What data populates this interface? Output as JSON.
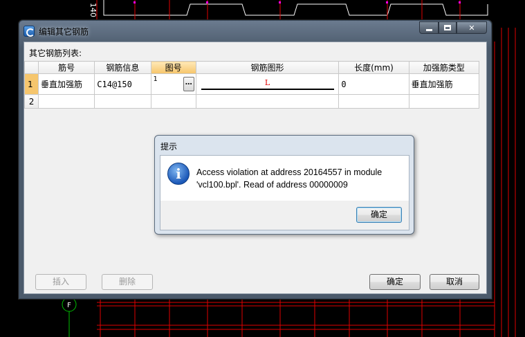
{
  "dialog": {
    "title": "编辑其它钢筋",
    "list_label": "其它钢筋列表:",
    "columns": [
      "筋号",
      "钢筋信息",
      "图号",
      "钢筋图形",
      "长度(mm)",
      "加强筋类型"
    ],
    "rows": [
      {
        "num": "1",
        "name": "垂直加强筋",
        "info": "C14@150",
        "map_no": "1",
        "figure_label": "L",
        "length": "0",
        "type": "垂直加强筋"
      },
      {
        "num": "2",
        "name": "",
        "info": "",
        "map_no": "",
        "figure_label": "",
        "length": "",
        "type": ""
      }
    ],
    "browse_label": "…",
    "buttons": {
      "insert": "插入",
      "delete": "删除",
      "ok": "确定",
      "cancel": "取消"
    }
  },
  "message_box": {
    "title": "提示",
    "icon": "info-icon",
    "text": "Access violation at address 20164557 in module 'vcl100.bpl'. Read of address 00000009",
    "ok": "确定"
  },
  "cad_background": {
    "label": "F",
    "side_text": "140"
  },
  "colors": {
    "selected_header": "#f6c56a",
    "figure_label": "#e00000",
    "cad_lines": "#e00000",
    "cad_points": "#ff00ff"
  }
}
